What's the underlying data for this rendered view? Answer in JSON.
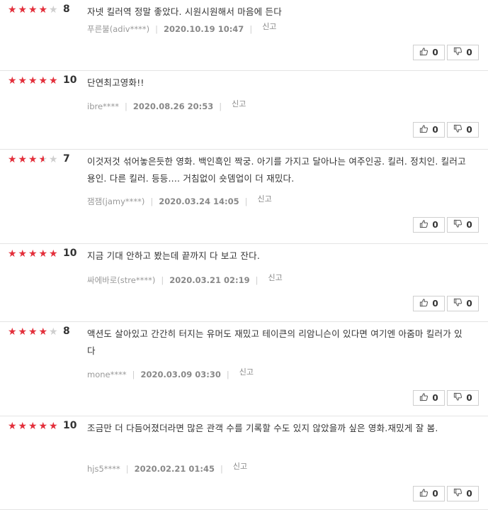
{
  "reviews": [
    {
      "score": "8",
      "rating": 4,
      "text": "자넷 킬러역 정말 좋았다. 시원시원해서 마음에 든다",
      "user": "푸른불(adiv****)",
      "date": "2020.10.19 10:47",
      "report": "신고",
      "like": "0",
      "dislike": "0"
    },
    {
      "score": "10",
      "rating": 5,
      "text": "단연최고영화!!",
      "user": "ibre****",
      "date": "2020.08.26 20:53",
      "report": "신고",
      "like": "0",
      "dislike": "0"
    },
    {
      "score": "7",
      "rating": 3.5,
      "text": "이것저것 섞어놓은듯한 영화. 백인흑인 짝궁. 아기를 가지고 달아나는 여주인공. 킬러. 정치인. 킬러고용인. 다른 킬러. 등등.... 거침없이 숏뎀업이 더 재밌다.",
      "user": "잼잼(jamy****)",
      "date": "2020.03.24 14:05",
      "report": "신고",
      "like": "0",
      "dislike": "0"
    },
    {
      "score": "10",
      "rating": 5,
      "text": "지금 기대 안하고 봤는데 끝까지 다 보고 잔다.",
      "user": "싸에바로(stre****)",
      "date": "2020.03.21 02:19",
      "report": "신고",
      "like": "0",
      "dislike": "0"
    },
    {
      "score": "8",
      "rating": 4,
      "text": "액션도 살아있고 간간히 터지는 유머도 재밌고 테이큰의 리암니슨이 있다면 여기엔 아줌마 킬러가 있다",
      "user": "mone****",
      "date": "2020.03.09 03:30",
      "report": "신고",
      "like": "0",
      "dislike": "0"
    },
    {
      "score": "10",
      "rating": 5,
      "text": "조금만 더 다듬어졌더라면 많은 관객 수를 기록할 수도 있지 않았을까 싶은 영화.재밌게 잘 봄.",
      "user": "hjs5****",
      "date": "2020.02.21 01:45",
      "report": "신고",
      "like": "0",
      "dislike": "0"
    }
  ]
}
